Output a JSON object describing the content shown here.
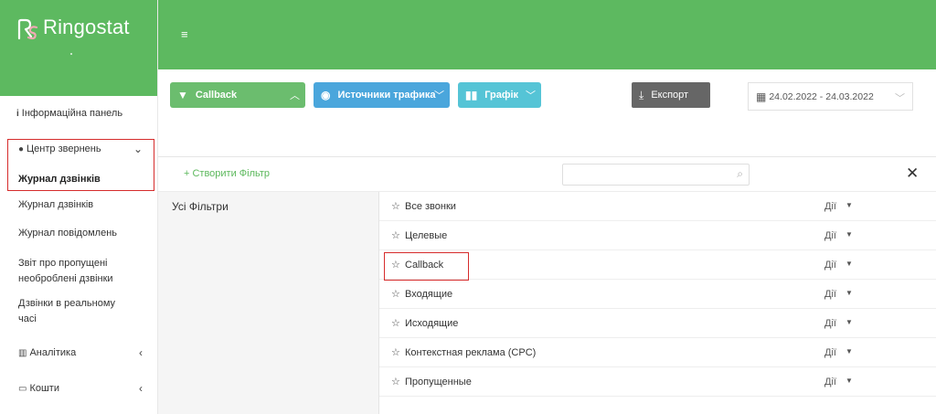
{
  "brand": {
    "name": "Ringostat",
    "primary_color": "#5db960"
  },
  "sidebar": {
    "info_panel": "Інформаційна панель",
    "center": "Центр звернень",
    "center_active": "Журнал дзвінків",
    "items": [
      "Журнал дзвінків",
      "Журнал повідомлень",
      "Звіт про пропущені",
      "необроблені дзвінки",
      "Дзвінки в реальному",
      "часі"
    ],
    "analytics": "Аналітика",
    "funds": "Кошти"
  },
  "toolbar": {
    "callback_label": "Callback",
    "sources_label": "Источники трафика",
    "graph_label": "Графік",
    "export_label": "Експорт",
    "date_range": "24.02.2022  -  24.03.2022"
  },
  "filters": {
    "create_label": "+ Створити Фільтр",
    "all_filters": "Усі Фільтри",
    "search_placeholder": "",
    "action_label": "Дії",
    "rows": [
      "Все звонки",
      "Целевые",
      "Callback",
      "Входящие",
      "Исходящие",
      "Контекстная реклама (CPC)",
      "Пропущенные"
    ]
  }
}
